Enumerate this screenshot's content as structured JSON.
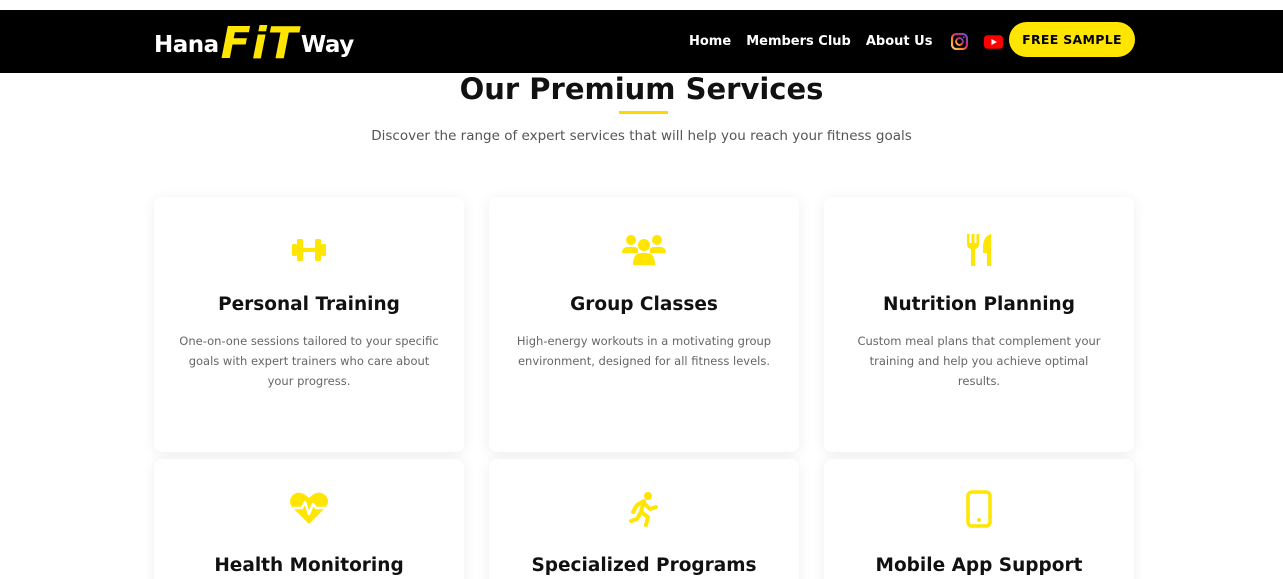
{
  "brand": {
    "part1": "Hana",
    "part2": "FiT",
    "part3": "Way",
    "accent": "#ffe500"
  },
  "nav": {
    "links": [
      "Home",
      "Members Club",
      "About Us"
    ],
    "cta": "FREE SAMPLE"
  },
  "section": {
    "title": "Our Premium Services",
    "subtitle": "Discover the range of expert services that will help you reach your fitness goals"
  },
  "services": [
    {
      "title": "Personal Training",
      "description": "One-on-one sessions tailored to your specific goals with expert trainers who care about your progress.",
      "icon": "dumbbell-icon"
    },
    {
      "title": "Group Classes",
      "description": "High-energy workouts in a motivating group environment, designed for all fitness levels.",
      "icon": "users-icon"
    },
    {
      "title": "Nutrition Planning",
      "description": "Custom meal plans that complement your training and help you achieve optimal results.",
      "icon": "utensils-icon"
    },
    {
      "title": "Health Monitoring",
      "description": "",
      "icon": "heartbeat-icon"
    },
    {
      "title": "Specialized Programs",
      "description": "",
      "icon": "running-icon"
    },
    {
      "title": "Mobile App Support",
      "description": "",
      "icon": "mobile-icon"
    }
  ]
}
